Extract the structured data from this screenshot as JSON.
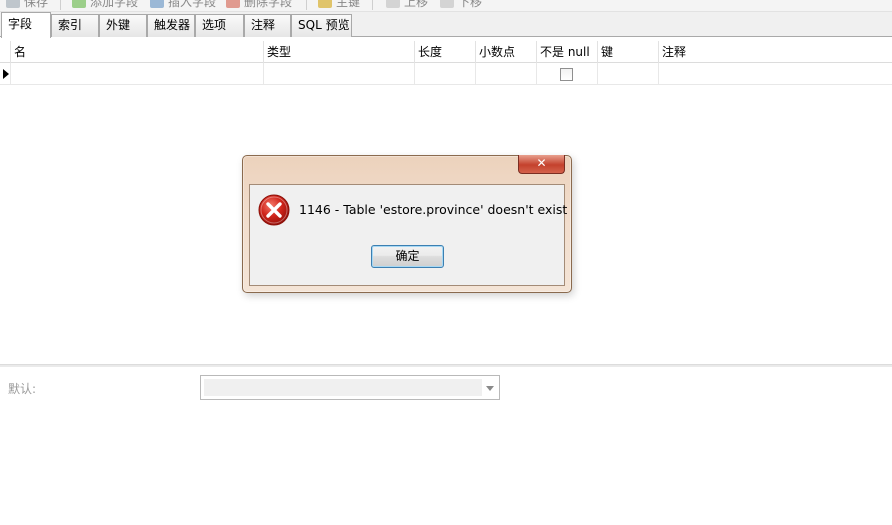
{
  "toolbar": {
    "items": [
      {
        "label": "保存"
      },
      {
        "label": "添加字段"
      },
      {
        "label": "插入字段"
      },
      {
        "label": "删除字段"
      },
      {
        "label": "主键"
      },
      {
        "label": "上移"
      },
      {
        "label": "下移"
      }
    ]
  },
  "tabs": [
    {
      "label": "字段"
    },
    {
      "label": "索引"
    },
    {
      "label": "外键"
    },
    {
      "label": "触发器"
    },
    {
      "label": "选项"
    },
    {
      "label": "注释"
    },
    {
      "label": "SQL 预览"
    }
  ],
  "grid": {
    "columns": [
      "名",
      "类型",
      "长度",
      "小数点",
      "不是 null",
      "键",
      "注释"
    ]
  },
  "bottom": {
    "default_label": "默认:"
  },
  "dialog": {
    "close_glyph": "✕",
    "message": "1146 - Table 'estore.province' doesn't exist",
    "ok_label": "确定"
  }
}
